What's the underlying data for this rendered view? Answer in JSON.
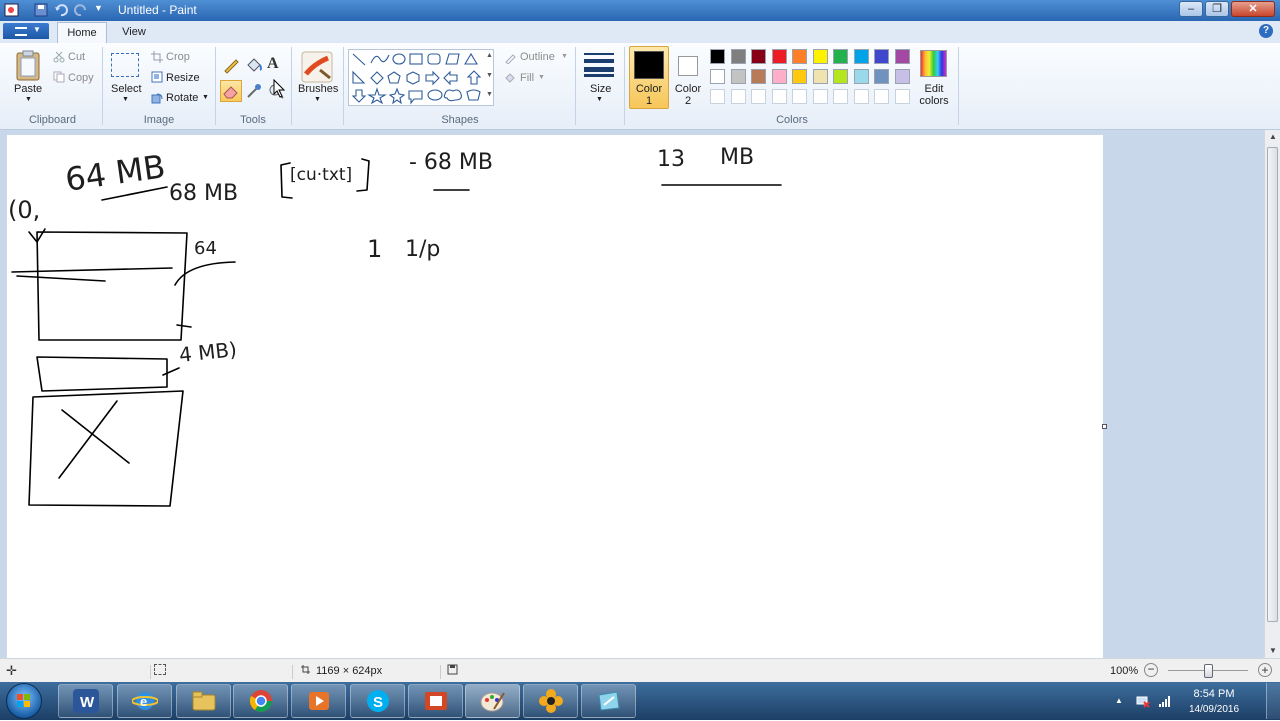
{
  "window": {
    "title": "Untitled - Paint"
  },
  "tabs": {
    "home": "Home",
    "view": "View"
  },
  "help": "?",
  "clipboard": {
    "paste": "Paste",
    "cut": "Cut",
    "copy": "Copy",
    "label": "Clipboard"
  },
  "image": {
    "select": "Select",
    "crop": "Crop",
    "resize": "Resize",
    "rotate": "Rotate",
    "label": "Image"
  },
  "tools": {
    "text_tool": "A",
    "label": "Tools"
  },
  "brushes": {
    "label": "Brushes"
  },
  "shapes": {
    "outline": "Outline",
    "fill": "Fill",
    "label": "Shapes"
  },
  "size": {
    "label": "Size"
  },
  "colors": {
    "color1": "Color 1",
    "color2": "Color 2",
    "edit": "Edit colors",
    "label": "Colors",
    "color1_value": "#000000",
    "color2_value": "#ffffff",
    "palette_row1": [
      "#000000",
      "#7f7f7f",
      "#880015",
      "#ed1c24",
      "#ff7f27",
      "#fff200",
      "#22b14c",
      "#00a2e8",
      "#3f48cc",
      "#a349a4"
    ],
    "palette_row2": [
      "#ffffff",
      "#c3c3c3",
      "#b97a57",
      "#ffaec9",
      "#ffc90e",
      "#efe4b0",
      "#b5e61d",
      "#99d9ea",
      "#7092be",
      "#c8bfe7"
    ]
  },
  "canvas_text": {
    "t1": "64 MB",
    "t2": "68 MB",
    "t3": "(0,",
    "t4": "64",
    "t5": "4 MB)",
    "t6": "[cu·txt]",
    "t7": "- 68 MB",
    "t8": "1",
    "t9": "1/p",
    "t10": "13",
    "t11": "MB"
  },
  "status": {
    "dimensions": "1169 × 624px",
    "zoom": "100%",
    "zoom_level": 0.5
  },
  "taskbar": {
    "time": "8:54 PM",
    "date": "14/09/2016"
  }
}
